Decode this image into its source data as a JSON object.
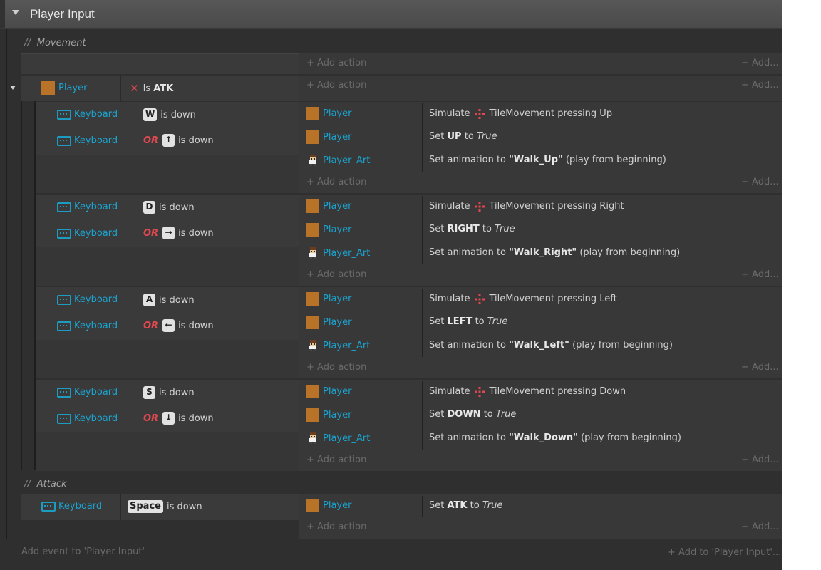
{
  "group_title": "Player Input",
  "comments": {
    "movement": "Movement",
    "attack": "Attack"
  },
  "comment_prefix": "//",
  "add_action": "+ Add action",
  "add_other": "+ Add...",
  "add_event": "Add event to 'Player Input'",
  "add_to_group": "+ Add to 'Player Input'...",
  "colors": {
    "object_icon": "#b87328",
    "keyboard": "#1ba3cf",
    "or": "#e0484f",
    "tilemovement_icon": "#e0484f"
  },
  "top_event": {
    "object": "Player",
    "condition_prefix": "Is",
    "condition_var": "ATK"
  },
  "sub_events": [
    {
      "conditions": [
        {
          "object": "Keyboard",
          "or": "",
          "key": "W",
          "text": "is down"
        },
        {
          "object": "Keyboard",
          "or": "OR",
          "key": "↑",
          "text": "is down"
        }
      ],
      "actions": [
        {
          "object": "Player",
          "parts": [
            "Simulate",
            "TileMovement pressing Up"
          ]
        },
        {
          "object": "Player",
          "parts": [
            "Set",
            "UP",
            "to",
            "True"
          ]
        },
        {
          "object": "Player_Art",
          "parts": [
            "Set animation to",
            "\"Walk_Up\"",
            "(play from beginning)"
          ]
        }
      ]
    },
    {
      "conditions": [
        {
          "object": "Keyboard",
          "or": "",
          "key": "D",
          "text": "is down"
        },
        {
          "object": "Keyboard",
          "or": "OR",
          "key": "→",
          "text": "is down"
        }
      ],
      "actions": [
        {
          "object": "Player",
          "parts": [
            "Simulate",
            "TileMovement pressing Right"
          ]
        },
        {
          "object": "Player",
          "parts": [
            "Set",
            "RIGHT",
            "to",
            "True"
          ]
        },
        {
          "object": "Player_Art",
          "parts": [
            "Set animation to",
            "\"Walk_Right\"",
            "(play from beginning)"
          ]
        }
      ]
    },
    {
      "conditions": [
        {
          "object": "Keyboard",
          "or": "",
          "key": "A",
          "text": "is down"
        },
        {
          "object": "Keyboard",
          "or": "OR",
          "key": "←",
          "text": "is down"
        }
      ],
      "actions": [
        {
          "object": "Player",
          "parts": [
            "Simulate",
            "TileMovement pressing Left"
          ]
        },
        {
          "object": "Player",
          "parts": [
            "Set",
            "LEFT",
            "to",
            "True"
          ]
        },
        {
          "object": "Player_Art",
          "parts": [
            "Set animation to",
            "\"Walk_Left\"",
            "(play from beginning)"
          ]
        }
      ]
    },
    {
      "conditions": [
        {
          "object": "Keyboard",
          "or": "",
          "key": "S",
          "text": "is down"
        },
        {
          "object": "Keyboard",
          "or": "OR",
          "key": "↓",
          "text": "is down"
        }
      ],
      "actions": [
        {
          "object": "Player",
          "parts": [
            "Simulate",
            "TileMovement pressing Down"
          ]
        },
        {
          "object": "Player",
          "parts": [
            "Set",
            "DOWN",
            "to",
            "True"
          ]
        },
        {
          "object": "Player_Art",
          "parts": [
            "Set animation to",
            "\"Walk_Down\"",
            "(play from beginning)"
          ]
        }
      ]
    }
  ],
  "attack_event": {
    "object": "Keyboard",
    "key": "Space",
    "text": "is down",
    "action_object": "Player",
    "action_parts": [
      "Set",
      "ATK",
      "to",
      "True"
    ]
  }
}
